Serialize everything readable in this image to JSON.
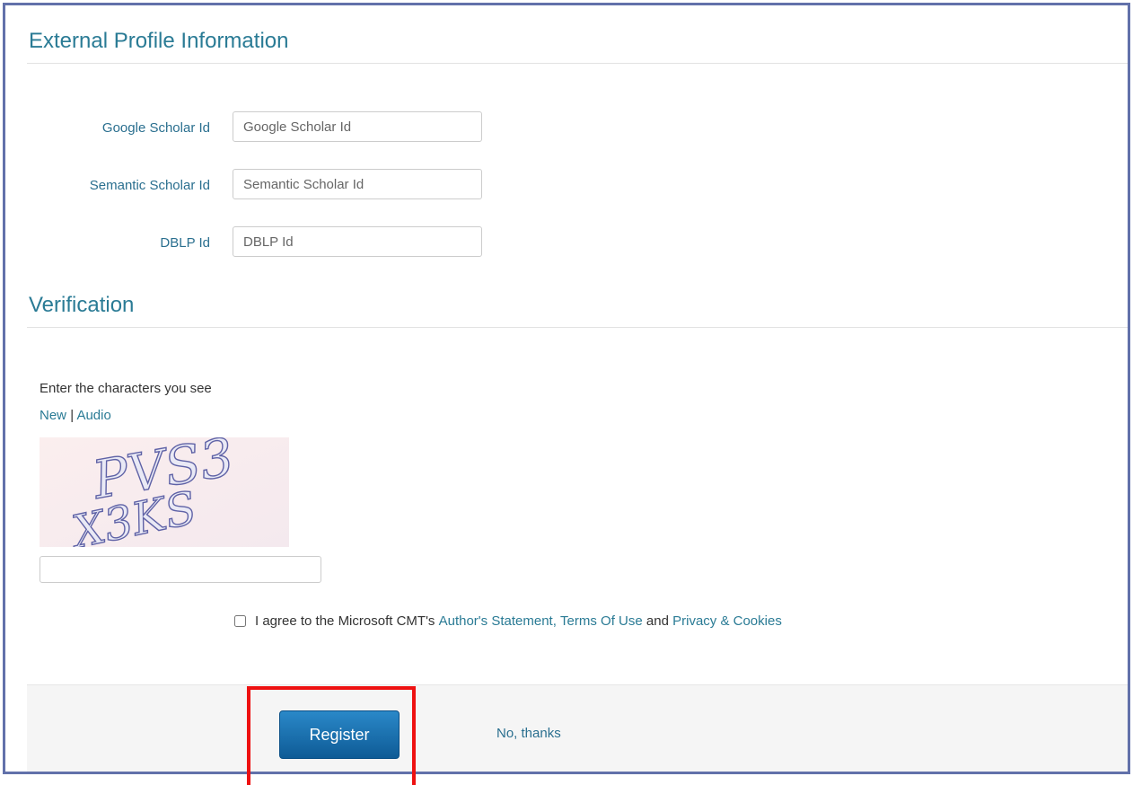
{
  "colors": {
    "frame_border": "#6271aa",
    "heading": "#2a7b95",
    "link": "#2a7b95",
    "primary_button": "#1768a8",
    "highlight": "#ee1111",
    "footer_bg": "#f5f5f5"
  },
  "external_profile": {
    "heading": "External Profile Information",
    "fields": [
      {
        "label": "Google Scholar Id",
        "placeholder": "Google Scholar Id",
        "value": ""
      },
      {
        "label": "Semantic Scholar Id",
        "placeholder": "Semantic Scholar Id",
        "value": ""
      },
      {
        "label": "DBLP Id",
        "placeholder": "DBLP Id",
        "value": ""
      }
    ]
  },
  "verification": {
    "heading": "Verification",
    "prompt": "Enter the characters you see",
    "new_link": "New",
    "separator": "|",
    "audio_link": "Audio",
    "captcha_text": [
      "PVS3",
      "X3KS"
    ],
    "captcha_value": ""
  },
  "agreement": {
    "checked": false,
    "prefix": "I agree to the Microsoft CMT's",
    "authors_statement_link": "Author's Statement,",
    "terms_link": "Terms Of Use",
    "and": "and",
    "privacy_link": "Privacy & Cookies"
  },
  "footer": {
    "register_label": "Register",
    "no_thanks_label": "No, thanks"
  }
}
